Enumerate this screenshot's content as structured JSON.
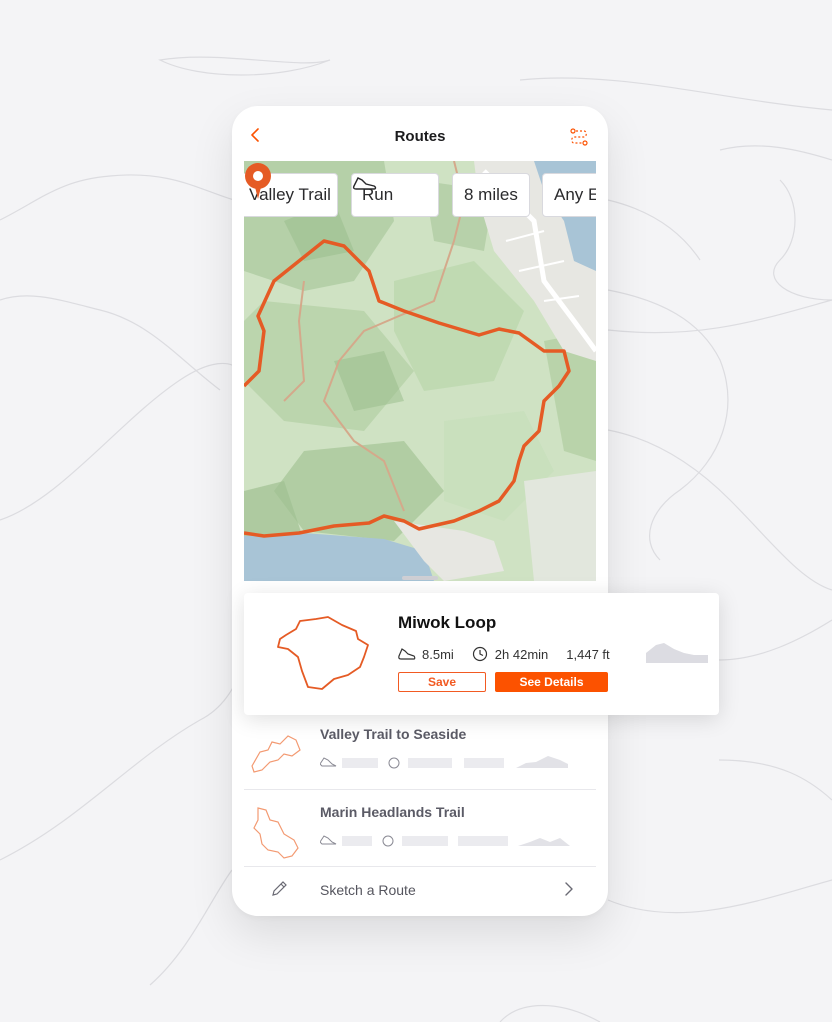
{
  "nav": {
    "title": "Routes",
    "back_icon": "chevron-left-icon",
    "route_icon": "route-icon"
  },
  "filters": [
    {
      "label": "Valley Trail"
    },
    {
      "label": "Run",
      "icon": "shoe-icon"
    },
    {
      "label": "8 miles"
    },
    {
      "label": "Any E"
    }
  ],
  "selected_route": {
    "title": "Miwok Loop",
    "distance": "8.5mi",
    "time": "2h 42min",
    "elevation": "1,447 ft",
    "save_label": "Save",
    "details_label": "See Details"
  },
  "routes": [
    {
      "title": "Valley Trail to Seaside"
    },
    {
      "title": "Marin Headlands Trail"
    }
  ],
  "sketch": {
    "label": "Sketch a Route",
    "icon": "pencil-icon"
  },
  "colors": {
    "accent": "#fc5200",
    "route_line": "#e55b25",
    "map_green": "#cfe2c3",
    "water": "#a8c4d6",
    "background": "#f4f4f6"
  }
}
